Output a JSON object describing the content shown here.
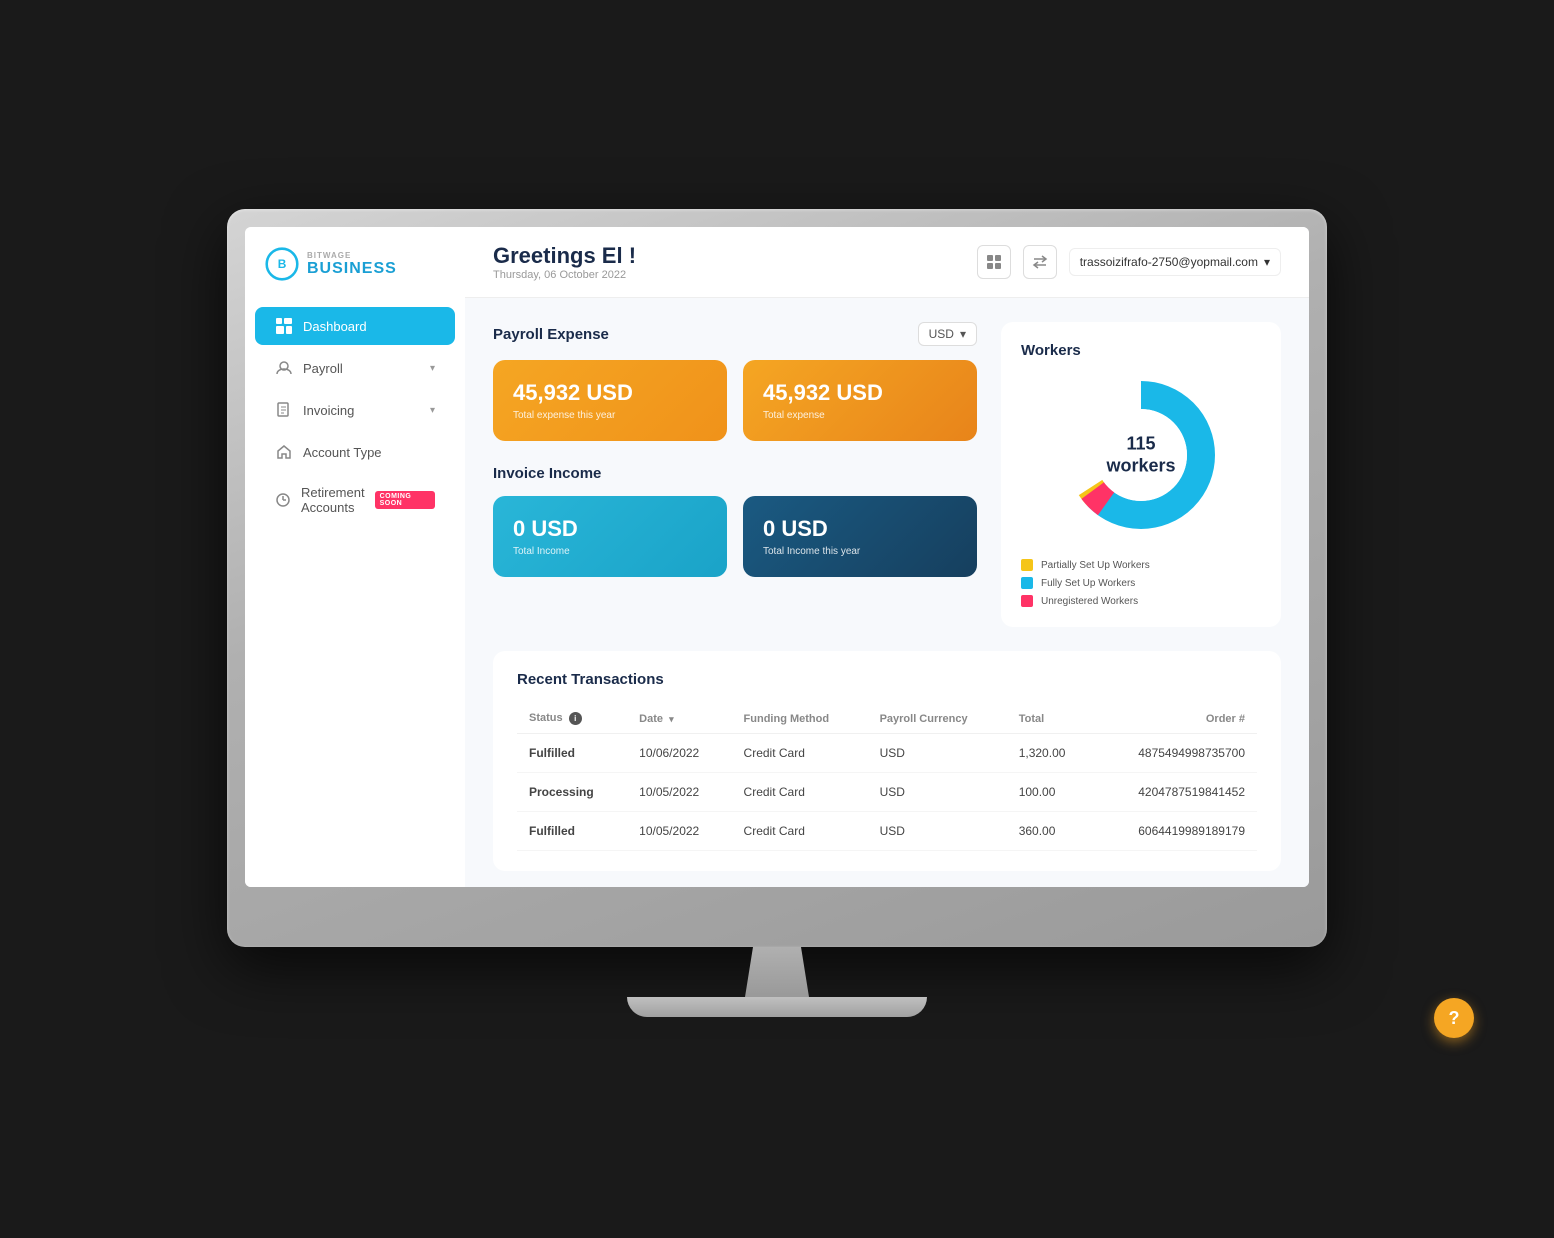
{
  "monitor": {
    "screen": {
      "header": {
        "greeting": "Greetings El !",
        "date": "Thursday, 06 October 2022",
        "user_email": "trassoizifrafo-2750@yopmail.com",
        "grid_icon": "grid-icon",
        "transfer_icon": "transfer-icon",
        "chevron_icon": "chevron-down-icon"
      },
      "sidebar": {
        "logo": {
          "bitwage": "bitwage",
          "business": "BUSINESS"
        },
        "nav_items": [
          {
            "id": "dashboard",
            "label": "Dashboard",
            "icon": "dashboard-icon",
            "active": true,
            "has_chevron": false,
            "badge": null
          },
          {
            "id": "payroll",
            "label": "Payroll",
            "icon": "payroll-icon",
            "active": false,
            "has_chevron": true,
            "badge": null
          },
          {
            "id": "invoicing",
            "label": "Invoicing",
            "icon": "invoice-icon",
            "active": false,
            "has_chevron": true,
            "badge": null
          },
          {
            "id": "account-type",
            "label": "Account Type",
            "icon": "account-icon",
            "active": false,
            "has_chevron": false,
            "badge": null
          },
          {
            "id": "retirement",
            "label": "Retirement Accounts",
            "icon": "retirement-icon",
            "active": false,
            "has_chevron": false,
            "badge": "COMING SOON"
          }
        ]
      },
      "payroll_expense": {
        "title": "Payroll Expense",
        "currency": "USD",
        "card1_amount": "45,932 USD",
        "card1_label": "Total expense this year",
        "card2_amount": "45,932 USD",
        "card2_label": "Total expense"
      },
      "invoice_income": {
        "title": "Invoice Income",
        "card1_amount": "0 USD",
        "card1_label": "Total Income",
        "card2_amount": "0 USD",
        "card2_label": "Total Income this year"
      },
      "workers": {
        "title": "Workers",
        "total": "115 workers",
        "legend": [
          {
            "color": "#f5c518",
            "label": "Partially Set Up Workers"
          },
          {
            "color": "#1ab8e8",
            "label": "Fully Set Up Workers"
          },
          {
            "color": "#ff3366",
            "label": "Unregistered Workers"
          }
        ],
        "chart": {
          "partially": 3,
          "fully": 92,
          "unregistered": 5
        }
      },
      "transactions": {
        "title": "Recent Transactions",
        "columns": [
          "Status",
          "Date",
          "Funding Method",
          "Payroll Currency",
          "Total",
          "Order #"
        ],
        "rows": [
          {
            "status": "Fulfilled",
            "status_type": "fulfilled",
            "date": "10/06/2022",
            "funding": "Credit Card",
            "currency": "USD",
            "total": "1,320.00",
            "order": "4875494998735700"
          },
          {
            "status": "Processing",
            "status_type": "processing",
            "date": "10/05/2022",
            "funding": "Credit Card",
            "currency": "USD",
            "total": "100.00",
            "order": "4204787519841452"
          },
          {
            "status": "Fulfilled",
            "status_type": "fulfilled",
            "date": "10/05/2022",
            "funding": "Credit Card",
            "currency": "USD",
            "total": "360.00",
            "order": "6064419989189179"
          }
        ]
      },
      "help_btn": "?"
    }
  }
}
